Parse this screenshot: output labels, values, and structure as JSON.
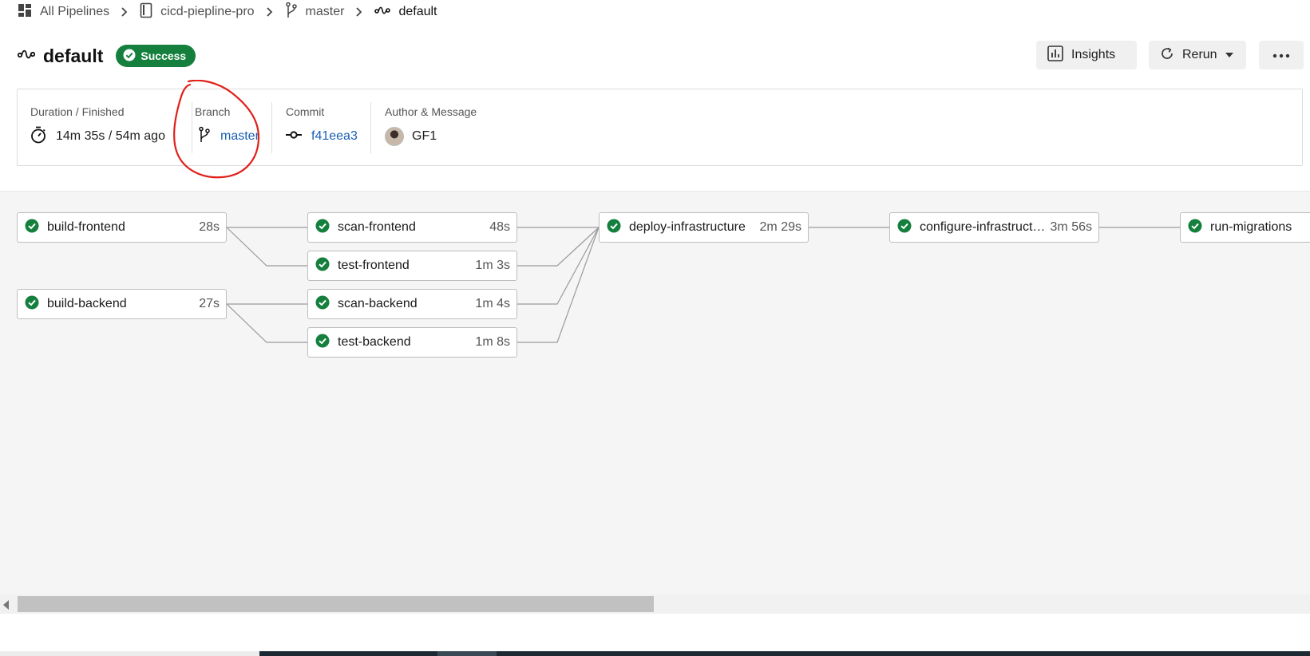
{
  "breadcrumb": {
    "all_pipelines": "All Pipelines",
    "project": "cicd-piepline-pro",
    "branch": "master",
    "pipeline": "default"
  },
  "header": {
    "title": "default",
    "status": "Success",
    "insights_label": "Insights",
    "rerun_label": "Rerun"
  },
  "info": {
    "duration_label": "Duration / Finished",
    "duration_value": "14m 35s / 54m ago",
    "branch_label": "Branch",
    "branch_value": "master",
    "commit_label": "Commit",
    "commit_value": "f41eea3",
    "author_label": "Author & Message",
    "author_value": "GF1"
  },
  "jobs": {
    "build_frontend": {
      "name": "build-frontend",
      "duration": "28s",
      "status": "success"
    },
    "build_backend": {
      "name": "build-backend",
      "duration": "27s",
      "status": "success"
    },
    "scan_frontend": {
      "name": "scan-frontend",
      "duration": "48s",
      "status": "success"
    },
    "test_frontend": {
      "name": "test-frontend",
      "duration": "1m 3s",
      "status": "success"
    },
    "scan_backend": {
      "name": "scan-backend",
      "duration": "1m 4s",
      "status": "success"
    },
    "test_backend": {
      "name": "test-backend",
      "duration": "1m 8s",
      "status": "success"
    },
    "deploy_infrastructure": {
      "name": "deploy-infrastructure",
      "duration": "2m 29s",
      "status": "success"
    },
    "configure_infrastructure": {
      "name": "configure-infrastructure",
      "duration": "3m 56s",
      "status": "success"
    },
    "run_migrations": {
      "name": "run-migrations",
      "duration": "",
      "status": "success"
    }
  },
  "colors": {
    "success": "#15803d",
    "link": "#1a5fb4",
    "annotation": "#e0201a"
  },
  "icons": {
    "breadcrumb_home": "grid-icon",
    "project": "repo-icon",
    "branch": "git-branch-icon",
    "pipeline": "pipeline-icon",
    "duration": "stopwatch-icon",
    "commit": "git-commit-icon",
    "insights": "bar-chart-icon",
    "rerun": "refresh-icon",
    "more": "more-horizontal-icon",
    "job_status": "check-circle-icon"
  }
}
